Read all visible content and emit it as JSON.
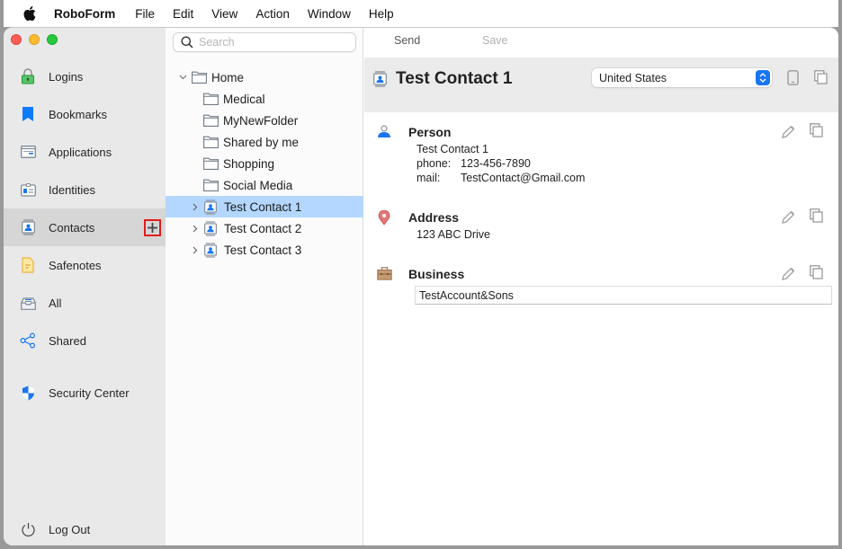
{
  "menubar": {
    "app_name": "RoboForm",
    "items": [
      "File",
      "Edit",
      "View",
      "Action",
      "Window",
      "Help"
    ]
  },
  "sidebar": {
    "items": [
      {
        "id": "logins",
        "label": "Logins",
        "icon": "lock-icon"
      },
      {
        "id": "bookmarks",
        "label": "Bookmarks",
        "icon": "bookmark-icon"
      },
      {
        "id": "applications",
        "label": "Applications",
        "icon": "application-window-icon"
      },
      {
        "id": "identities",
        "label": "Identities",
        "icon": "id-card-icon"
      },
      {
        "id": "contacts",
        "label": "Contacts",
        "icon": "contact-card-icon",
        "selected": true
      },
      {
        "id": "safenotes",
        "label": "Safenotes",
        "icon": "note-icon"
      },
      {
        "id": "all",
        "label": "All",
        "icon": "inbox-tray-icon"
      },
      {
        "id": "shared",
        "label": "Shared",
        "icon": "share-icon"
      },
      {
        "id": "security-center",
        "label": "Security Center",
        "icon": "shield-icon"
      }
    ],
    "logout_label": "Log Out",
    "add_button_icon": "plus-icon"
  },
  "tree": {
    "search_placeholder": "Search",
    "search_value": "",
    "rows": [
      {
        "label": "Home",
        "type": "folder",
        "level": 0,
        "expanded": true
      },
      {
        "label": "Medical",
        "type": "folder",
        "level": 1
      },
      {
        "label": "MyNewFolder",
        "type": "folder",
        "level": 1
      },
      {
        "label": "Shared by me",
        "type": "folder",
        "level": 1
      },
      {
        "label": "Shopping",
        "type": "folder",
        "level": 1
      },
      {
        "label": "Social Media",
        "type": "folder",
        "level": 1
      },
      {
        "label": "Test Contact 1",
        "type": "contact",
        "level": 1,
        "collapsed": true,
        "selected": true
      },
      {
        "label": "Test Contact 2",
        "type": "contact",
        "level": 1,
        "collapsed": true
      },
      {
        "label": "Test Contact 3",
        "type": "contact",
        "level": 1,
        "collapsed": true
      }
    ]
  },
  "toolbar": {
    "send_label": "Send",
    "save_label": "Save"
  },
  "contact": {
    "title": "Test Contact 1",
    "country": "United States",
    "sections": {
      "person": {
        "title": "Person",
        "name": "Test Contact 1",
        "phone_label": "phone:",
        "phone": "123-456-7890",
        "mail_label": "mail:",
        "mail": "TestContact@Gmail.com"
      },
      "address": {
        "title": "Address",
        "line1": "123 ABC Drive"
      },
      "business": {
        "title": "Business",
        "value": "TestAccount&Sons"
      }
    }
  },
  "colors": {
    "accent_blue": "#1b75f0",
    "selection": "#b3d7ff",
    "highlight_box": "#e21b1b"
  }
}
